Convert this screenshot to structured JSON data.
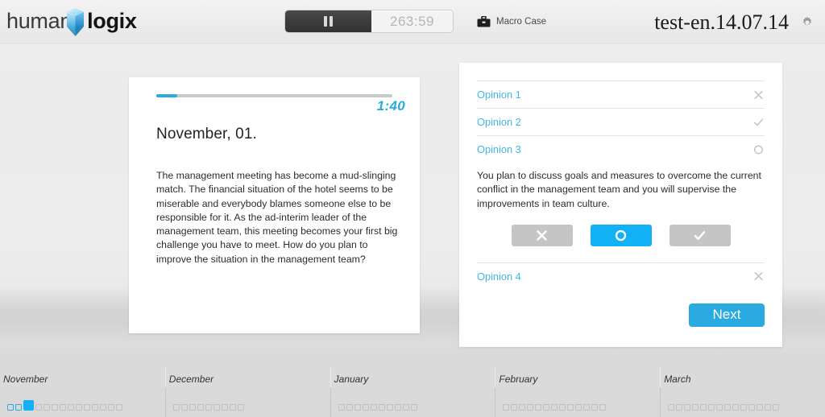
{
  "brand": {
    "logo_text_light": "human",
    "logo_text_bold": "logix",
    "logo_icon": "cube-icon",
    "accent_color": "#29abe2",
    "accent_bright": "#12b0f5",
    "link_color": "#3fb6ea"
  },
  "topbar": {
    "pause_icon": "pause-icon",
    "timer_value": "263:59",
    "macro_case_icon": "briefcase-icon",
    "macro_case_label": "Macro Case",
    "test_id": "test-en.14.07.14",
    "settings_icon": "gear-icon"
  },
  "scenario": {
    "progress_percent": 9,
    "timer_value": "1:40",
    "title": "November, 01.",
    "body": "The management meeting has become a mud-slinging match. The financial situation of the hotel seems to be miserable and everybody blames someone else to be responsible for it. As the ad-interim leader of the management team, this meeting becomes your first big challenge you have to meet. How do you plan to improve the situation in the management team?"
  },
  "opinions": {
    "rows": [
      {
        "label": "Opinion 1",
        "state": "rejected",
        "state_icon": "cross-icon"
      },
      {
        "label": "Opinion 2",
        "state": "accepted",
        "state_icon": "check-icon"
      },
      {
        "label": "Opinion 3",
        "state": "undecided",
        "state_icon": "circle-icon"
      }
    ],
    "expanded": {
      "text": "You plan to discuss goals and measures to overcome the current conflict in the management team and you will supervise the improvements in team culture.",
      "choices": [
        {
          "name": "reject",
          "icon": "cross-icon",
          "selected": false
        },
        {
          "name": "undecided",
          "icon": "circle-icon",
          "selected": true
        },
        {
          "name": "accept",
          "icon": "check-icon",
          "selected": false
        }
      ]
    },
    "trailing_rows": [
      {
        "label": "Opinion 4",
        "state": "rejected",
        "state_icon": "cross-icon"
      }
    ],
    "next_label": "Next"
  },
  "timeline": {
    "months": [
      {
        "label": "November",
        "done_days": 2,
        "current_day": true,
        "remaining_days": 11
      },
      {
        "label": "December",
        "done_days": 0,
        "current_day": false,
        "remaining_days": 9
      },
      {
        "label": "January",
        "done_days": 0,
        "current_day": false,
        "remaining_days": 10
      },
      {
        "label": "February",
        "done_days": 0,
        "current_day": false,
        "remaining_days": 13
      },
      {
        "label": "March",
        "done_days": 0,
        "current_day": false,
        "remaining_days": 14
      }
    ]
  }
}
